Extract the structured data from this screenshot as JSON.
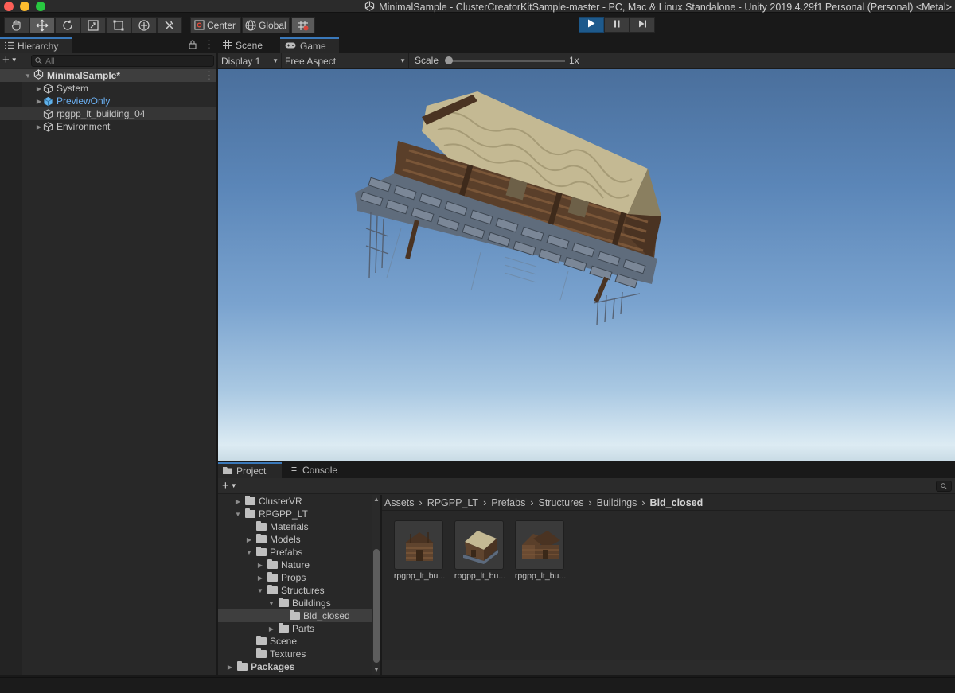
{
  "window": {
    "title": "MinimalSample - ClusterCreatorKitSample-master - PC, Mac & Linux Standalone - Unity 2019.4.29f1 Personal (Personal) <Metal>",
    "traffic_lights": {
      "close": "#fe5f57",
      "minimize": "#febc2e",
      "zoom": "#28c840"
    }
  },
  "toolbar": {
    "tools": [
      "hand-tool",
      "move-tool",
      "rotate-tool",
      "scale-tool",
      "rect-tool",
      "transform-tool",
      "custom-tool"
    ],
    "pivot_label": "Center",
    "space_label": "Global",
    "play_state": "playing"
  },
  "hierarchy": {
    "tab_label": "Hierarchy",
    "search_placeholder": "All",
    "scene_name": "MinimalSample*",
    "items": [
      {
        "label": "System",
        "expandable": true,
        "highlight": false
      },
      {
        "label": "PreviewOnly",
        "expandable": true,
        "highlight": true
      },
      {
        "label": "rpgpp_lt_building_04",
        "expandable": false,
        "highlight": false
      },
      {
        "label": "Environment",
        "expandable": true,
        "highlight": false
      }
    ]
  },
  "view_tabs": {
    "scene_label": "Scene",
    "game_label": "Game"
  },
  "game_view": {
    "display_label": "Display 1",
    "aspect_label": "Free Aspect",
    "scale_label": "Scale",
    "scale_value": "1x"
  },
  "bottom_tabs": {
    "project_label": "Project",
    "console_label": "Console"
  },
  "project_tree": [
    {
      "label": "ClusterVR",
      "depth": 1,
      "arrow": "closed",
      "bold": false,
      "selected": false
    },
    {
      "label": "RPGPP_LT",
      "depth": 1,
      "arrow": "open",
      "bold": false,
      "selected": false
    },
    {
      "label": "Materials",
      "depth": 2,
      "arrow": "none",
      "bold": false,
      "selected": false
    },
    {
      "label": "Models",
      "depth": 2,
      "arrow": "closed",
      "bold": false,
      "selected": false
    },
    {
      "label": "Prefabs",
      "depth": 2,
      "arrow": "open",
      "bold": false,
      "selected": false
    },
    {
      "label": "Nature",
      "depth": 3,
      "arrow": "closed",
      "bold": false,
      "selected": false
    },
    {
      "label": "Props",
      "depth": 3,
      "arrow": "closed",
      "bold": false,
      "selected": false
    },
    {
      "label": "Structures",
      "depth": 3,
      "arrow": "open",
      "bold": false,
      "selected": false
    },
    {
      "label": "Buildings",
      "depth": 4,
      "arrow": "open",
      "bold": false,
      "selected": false
    },
    {
      "label": "Bld_closed",
      "depth": 5,
      "arrow": "none",
      "bold": false,
      "selected": true
    },
    {
      "label": "Parts",
      "depth": 4,
      "arrow": "closed",
      "bold": false,
      "selected": false
    },
    {
      "label": "Scene",
      "depth": 2,
      "arrow": "none",
      "bold": false,
      "selected": false
    },
    {
      "label": "Textures",
      "depth": 2,
      "arrow": "none",
      "bold": false,
      "selected": false
    },
    {
      "label": "Packages",
      "depth": 0,
      "arrow": "closed",
      "bold": true,
      "selected": false
    }
  ],
  "breadcrumb": [
    "Assets",
    "RPGPP_LT",
    "Prefabs",
    "Structures",
    "Buildings",
    "Bld_closed"
  ],
  "assets": [
    {
      "label": "rpgpp_lt_bu..."
    },
    {
      "label": "rpgpp_lt_bu..."
    },
    {
      "label": "rpgpp_lt_bu..."
    }
  ]
}
